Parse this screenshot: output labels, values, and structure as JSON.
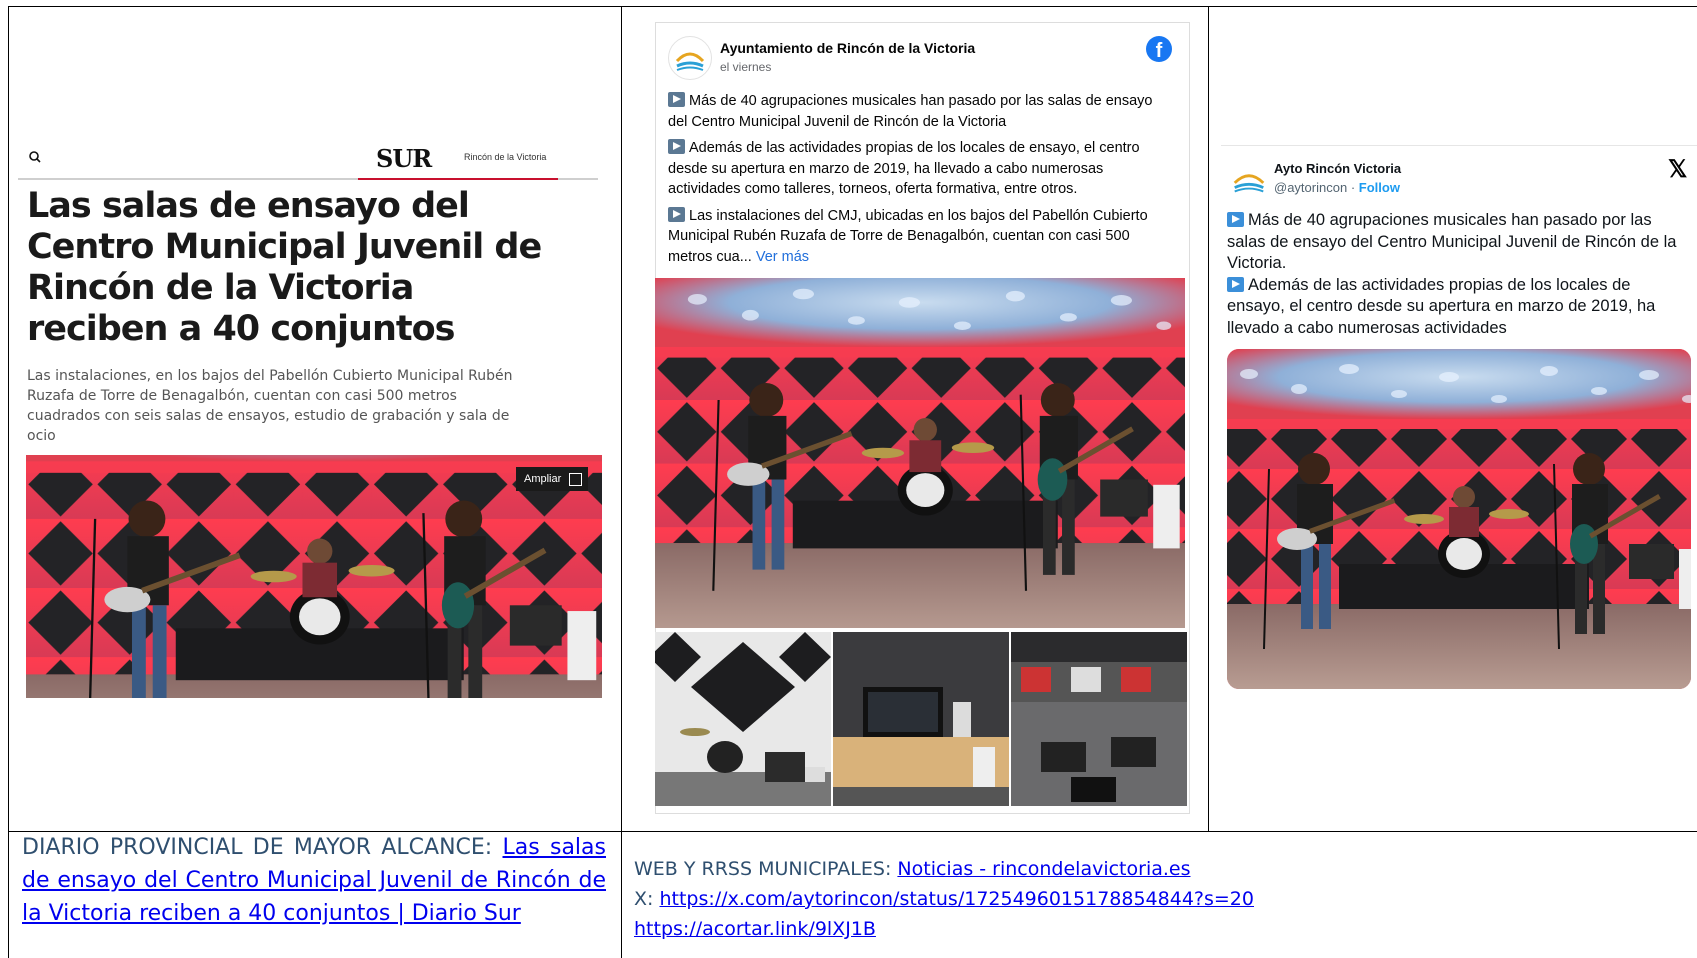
{
  "sur": {
    "section": "Rincón de la Victoria",
    "logo": "SUR",
    "title": "Las salas de ensayo del Centro Municipal Juvenil de Rincón de la Victoria reciben a 40 conjuntos",
    "description": "Las instalaciones, en los bajos del Pabellón Cubierto Municipal Rubén Ruzafa de Torre de Benagalbón, cuentan con casi 500 metros cuadrados con seis salas de ensayos, estudio de grabación y sala de ocio",
    "expand_label": "Ampliar"
  },
  "facebook": {
    "page_name": "Ayuntamiento de Rincón de la Victoria",
    "time": "el viernes",
    "paragraphs": [
      "Más de 40 agrupaciones musicales han pasado por las salas de ensayo del Centro Municipal Juvenil de Rincón de la Victoria",
      "Además de las actividades propias de los locales de ensayo, el centro desde su apertura en marzo de 2019, ha llevado a cabo numerosas actividades como talleres, torneos, oferta formativa, entre otros.",
      "Las instalaciones del CMJ, ubicadas en los bajos del Pabellón Cubierto Municipal Rubén Ruzafa de Torre de Benagalbón, cuentan con casi 500 metros cua..."
    ],
    "see_more": "Ver más"
  },
  "x": {
    "name": "Ayto Rincón Victoria",
    "handle": "@aytorincon",
    "separator": "·",
    "follow": "Follow",
    "logo": "𝕏",
    "paragraphs": [
      "Más de 40 agrupaciones musicales han pasado por las salas de ensayo del Centro Municipal Juvenil de Rincón de la Victoria.",
      "Además de las actividades propias de los locales de ensayo, el centro desde su apertura en marzo de 2019, ha llevado a cabo numerosas actividades"
    ]
  },
  "captions": {
    "left_label": "DIARIO PROVINCIAL DE MAYOR ALCANCE: ",
    "left_link": "Las salas de ensayo del Centro Municipal Juvenil de Rincón de la Victoria reciben a 40 conjuntos | Diario Sur",
    "right_label": "WEB Y RRSS MUNICIPALES: ",
    "right_link1": "Noticias - rincondelavictoria.es",
    "right_x_prefix": "X: ",
    "right_link2": "https://x.com/aytorincon/status/1725496015178854844?s=20",
    "right_link3": "https://acortar.link/9lXJ1B"
  },
  "colors": {
    "sur_red": "#c8102e",
    "facebook_blue": "#1877f2",
    "link_blue": "#0000ee",
    "caption_text": "#2f4f6f",
    "play_icon": "#5b7893"
  }
}
